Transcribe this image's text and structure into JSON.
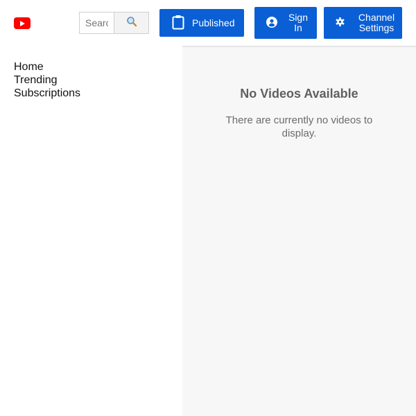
{
  "header": {
    "logo_icon": "youtube-logo-icon",
    "search": {
      "placeholder": "Search",
      "value": "",
      "button_icon": "search-icon"
    },
    "buttons": {
      "published": {
        "label": "Published",
        "icon": "clipboard-icon"
      },
      "sign_in": {
        "label": "Sign In",
        "icon": "account-circle-icon"
      },
      "channel_settings": {
        "label": "Channel Settings",
        "icon": "gear-icon"
      }
    },
    "accent_color": "#0b5fd4",
    "logo_color": "#ff0000"
  },
  "sidebar": {
    "items": [
      {
        "label": "Home"
      },
      {
        "label": "Trending"
      },
      {
        "label": "Subscriptions"
      }
    ]
  },
  "main": {
    "empty_title": "No Videos Available",
    "empty_message": "There are currently no videos to display."
  }
}
